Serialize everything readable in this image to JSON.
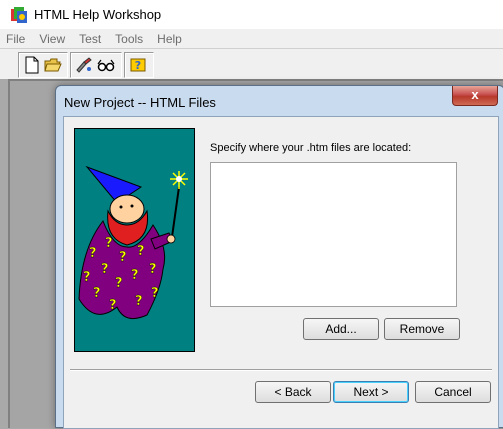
{
  "app": {
    "title": "HTML Help Workshop",
    "menu": [
      "File",
      "View",
      "Test",
      "Tools",
      "Help"
    ]
  },
  "toolbar": {
    "buttons": [
      "new-icon",
      "open-icon",
      "compile-icon",
      "view-icon",
      "help-icon"
    ]
  },
  "dialog": {
    "title": "New Project -- HTML Files",
    "close_label": "x",
    "prompt": "Specify where your .htm files are located:",
    "file_list_items": [],
    "add_label": "Add...",
    "remove_label": "Remove",
    "back_label": "< Back",
    "next_label": "Next >",
    "cancel_label": "Cancel"
  },
  "colors": {
    "wizard_background": "#008080",
    "robe": "#800080",
    "question_marks": "#ffff00",
    "close_button": "#c75050"
  }
}
